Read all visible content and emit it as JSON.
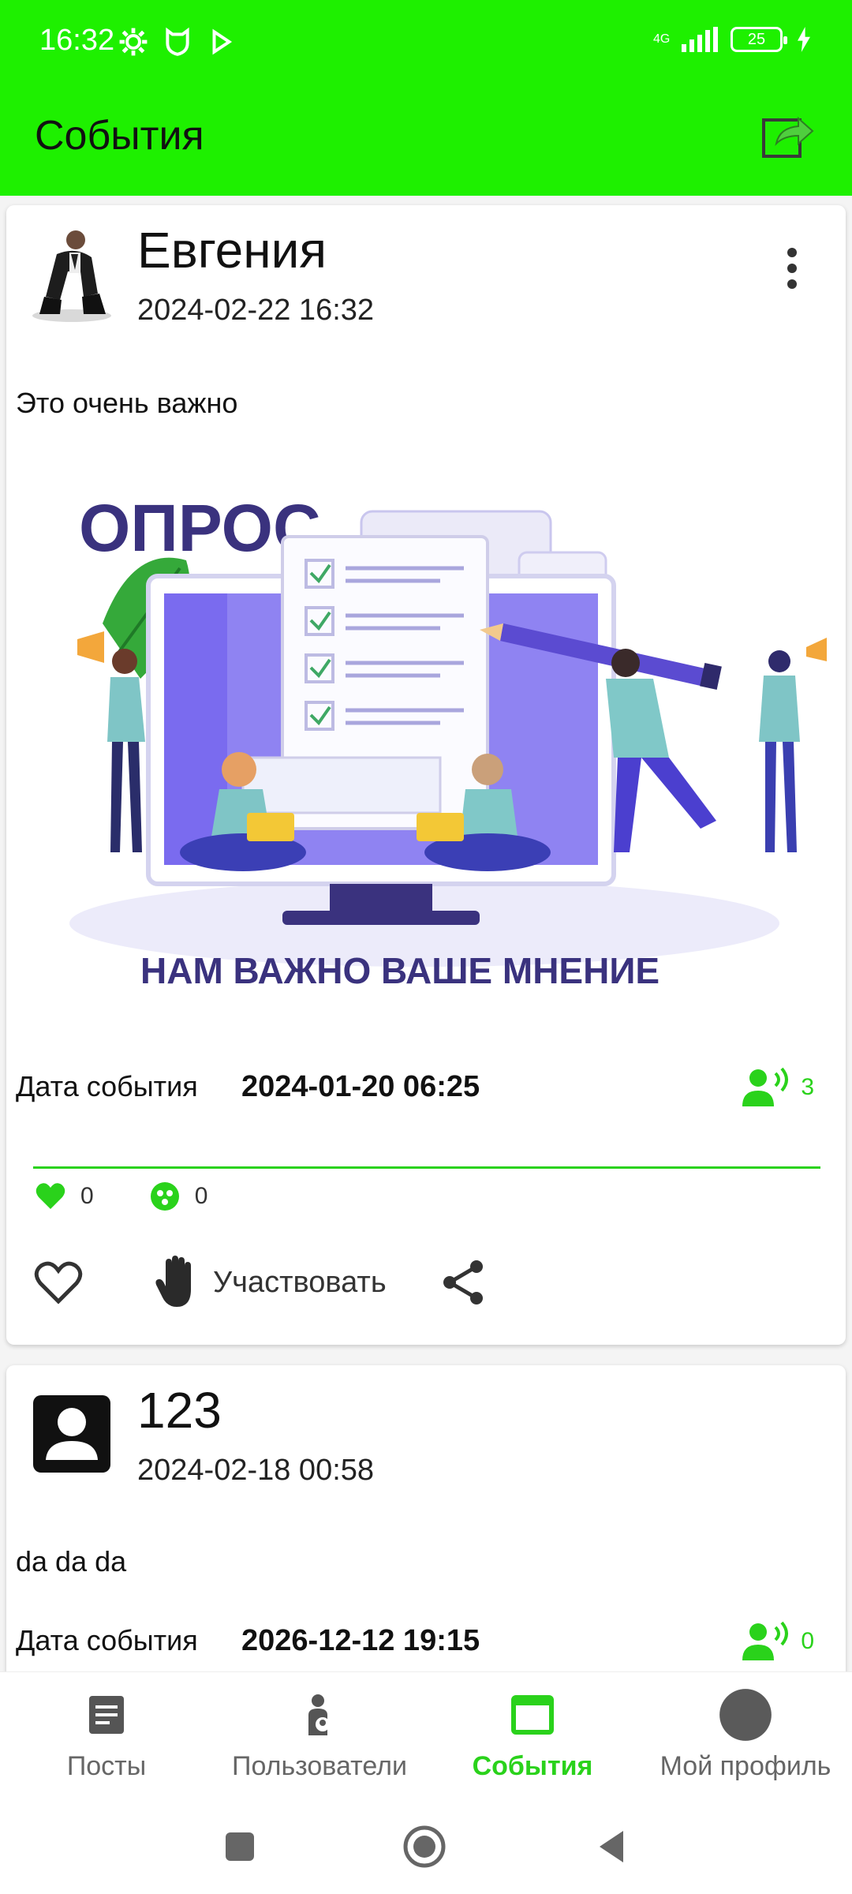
{
  "status_bar": {
    "time": "16:32",
    "network": "4G",
    "battery": "25"
  },
  "app_bar": {
    "title": "События",
    "share_icon": "share-external-icon"
  },
  "posts": [
    {
      "author": "Евгения",
      "date": "2024-02-22 16:32",
      "text": "Это очень важно",
      "image": {
        "headline": "ОПРОС",
        "tagline": "НАМ ВАЖНО ВАШЕ МНЕНИЕ"
      },
      "event_label": "Дата события",
      "event_date": "2024-01-20 06:25",
      "participants": "3",
      "likes": "0",
      "reactions": "0",
      "participate_label": "Участвовать"
    },
    {
      "author": "123",
      "date": "2024-02-18 00:58",
      "text": "da da da",
      "event_label": "Дата события",
      "event_date": "2026-12-12 19:15",
      "participants": "0"
    }
  ],
  "bottom_nav": [
    {
      "label": "Посты",
      "icon": "article-icon",
      "active": false
    },
    {
      "label": "Пользователи",
      "icon": "users-icon",
      "active": false
    },
    {
      "label": "События",
      "icon": "calendar-window-icon",
      "active": true
    },
    {
      "label": "Мой профиль",
      "icon": "profile-avatar-icon",
      "active": false
    }
  ],
  "colors": {
    "primary": "#1ef000",
    "accent": "#2ad21b",
    "poster_purple": "#3a327e"
  }
}
